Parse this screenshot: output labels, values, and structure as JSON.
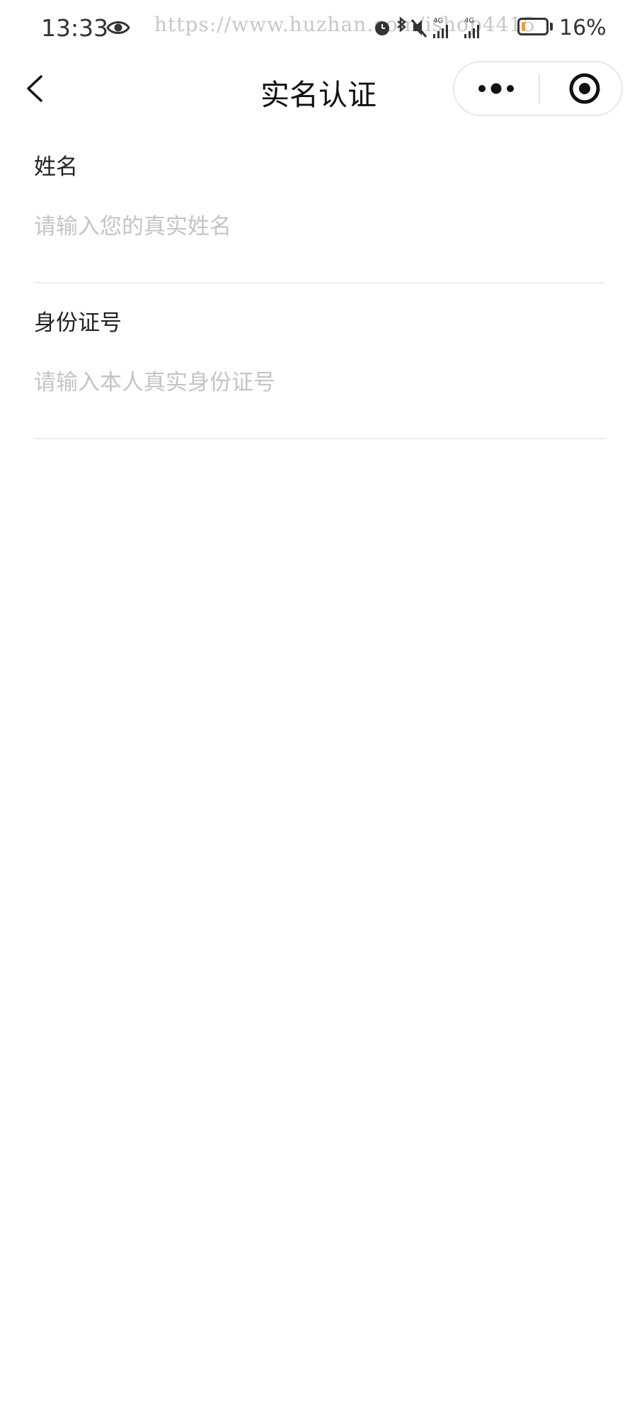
{
  "status_bar": {
    "time": "13:33",
    "watermark": "https://www.huzhan.com/ishop4415",
    "battery_percent": "16%",
    "battery_level": 0.16,
    "icons": [
      "eye-icon",
      "alarm-icon",
      "bluetooth-icon",
      "mute-icon",
      "signal-4g-icon",
      "signal-4g-icon",
      "battery-icon"
    ],
    "battery_color": "#e6a23c"
  },
  "nav": {
    "title": "实名认证",
    "back_icon": "chevron-left-icon",
    "more_icon": "more-dots-icon",
    "close_icon": "target-circle-icon"
  },
  "form": {
    "name": {
      "label": "姓名",
      "placeholder": "请输入您的真实姓名",
      "value": ""
    },
    "id_number": {
      "label": "身份证号",
      "placeholder": "请输入本人真实身份证号",
      "value": ""
    }
  }
}
